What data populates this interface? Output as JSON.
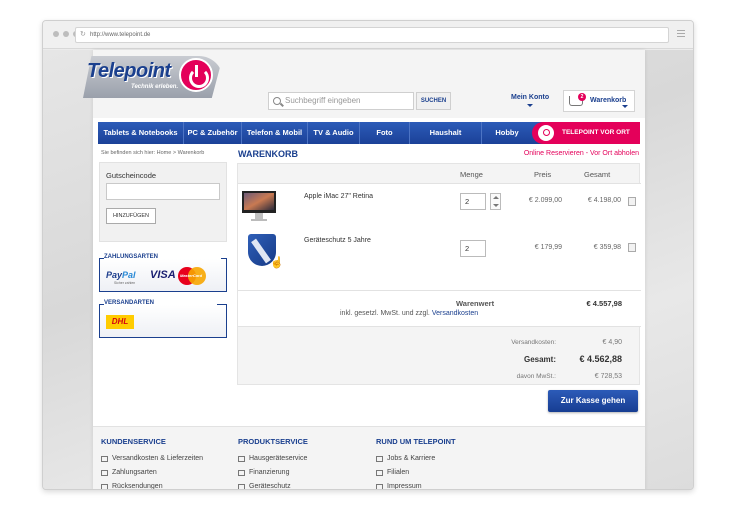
{
  "browser": {
    "url": "http://www.telepoint.de"
  },
  "header": {
    "logo_text": "Telepoint",
    "logo_tagline": "Technik erleben.",
    "search_placeholder": "Suchbegriff eingeben",
    "search_button": "SUCHEN",
    "account_label": "Mein Konto",
    "cart_label": "Warenkorb",
    "cart_count": "2"
  },
  "nav": {
    "items": [
      {
        "label": "Tablets & Notebooks",
        "width": 86
      },
      {
        "label": "PC & Zubehör",
        "width": 58
      },
      {
        "label": "Telefon & Mobil",
        "width": 66
      },
      {
        "label": "TV & Audio",
        "width": 52
      },
      {
        "label": "Foto",
        "width": 50
      },
      {
        "label": "Haushalt",
        "width": 72
      },
      {
        "label": "Hobby",
        "width": 50
      }
    ],
    "cta": "TELEPOINT VOR ORT"
  },
  "breadcrumb": "Sie befinden sich hier:  Home > Warenkorb",
  "page_title": "WARENKORB",
  "reserve_link": "Online Reservieren - Vor Ort abholen",
  "sidebar": {
    "voucher_label": "Gutscheincode",
    "voucher_value": "",
    "voucher_button": "HINZUFÜGEN",
    "payment_title": "ZAHLUNGSARTEN",
    "paypal_a": "Pay",
    "paypal_b": "Pal",
    "paypal_sub": "Sicher zahlen",
    "visa": "VISA",
    "mastercard": "MasterCard",
    "shipping_title": "VERSANDARTEN",
    "dhl": "DHL"
  },
  "cart": {
    "columns": {
      "qty": "Menge",
      "price": "Preis",
      "total": "Gesamt"
    },
    "items": [
      {
        "name": "Apple iMac 27\" Retina",
        "qty": "2",
        "price": "€ 2.099,00",
        "total": "€ 4.198,00"
      },
      {
        "name": "Geräteschutz 5 Jahre",
        "qty": "2",
        "price": "€ 179,99",
        "total": "€ 359,98"
      }
    ],
    "warenwert_label": "Warenwert",
    "warenwert": "€ 4.557,98",
    "incl_text": "inkl. gesetzl. MwSt. und zzgl. ",
    "shipping_link": "Versandkosten",
    "shipping_label": "Versandkosten:",
    "shipping_cost": "€ 4,90",
    "total_label": "Gesamt:",
    "total": "€ 4.562,88",
    "tax_label": "davon MwSt.:",
    "tax": "€ 728,53",
    "checkout_button": "Zur Kasse gehen"
  },
  "footer": {
    "columns": [
      {
        "title": "KUNDENSERVICE",
        "links": [
          "Versandkosten & Lieferzeiten",
          "Zahlungsarten",
          "Rücksendungen"
        ]
      },
      {
        "title": "PRODUKTSERVICE",
        "links": [
          "Hausgeräteservice",
          "Finanzierung",
          "Geräteschutz"
        ]
      },
      {
        "title": "RUND UM TELEPOINT",
        "links": [
          "Jobs & Karriere",
          "Filialen",
          "Impressum"
        ]
      }
    ]
  },
  "colors": {
    "brand_blue": "#1a3f8e",
    "accent_pink": "#e4005a"
  }
}
